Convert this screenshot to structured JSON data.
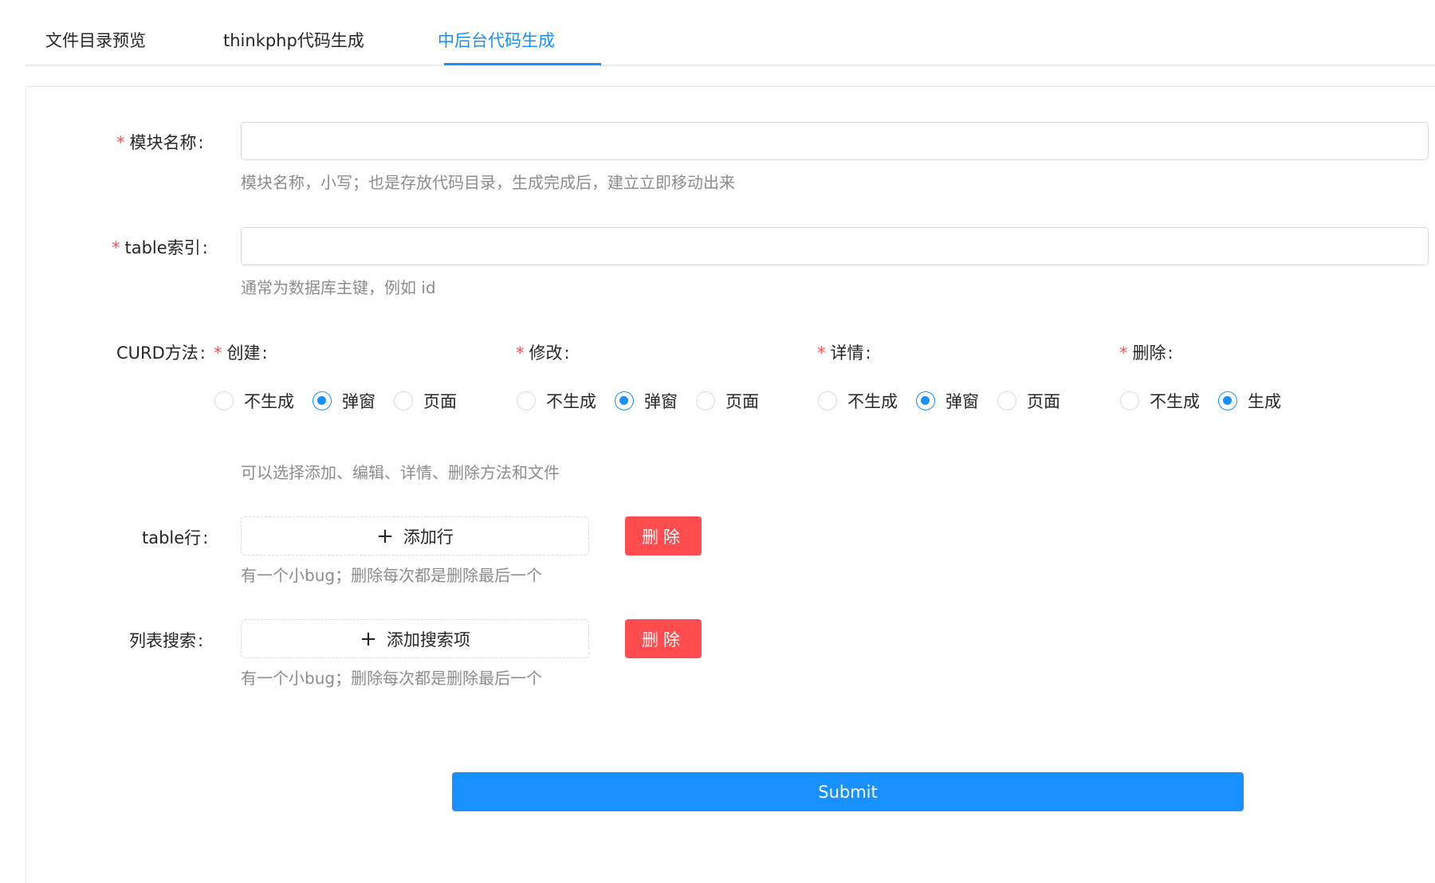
{
  "tabs": [
    {
      "label": "文件目录预览"
    },
    {
      "label": "thinkphp代码生成"
    },
    {
      "label": "中后台代码生成"
    }
  ],
  "form": {
    "module_name": {
      "label": "模块名称",
      "value": "",
      "help": "模块名称，小写；也是存放代码目录，生成完成后，建立立即移动出来"
    },
    "table_index": {
      "label": "table索引",
      "value": "",
      "help": "通常为数据库主键，例如 id"
    },
    "curd": {
      "label": "CURD方法",
      "help": "可以选择添加、编辑、详情、删除方法和文件",
      "groups": [
        {
          "label": "创建",
          "options": [
            "不生成",
            "弹窗",
            "页面"
          ],
          "selected": "弹窗"
        },
        {
          "label": "修改",
          "options": [
            "不生成",
            "弹窗",
            "页面"
          ],
          "selected": "弹窗"
        },
        {
          "label": "详情",
          "options": [
            "不生成",
            "弹窗",
            "页面"
          ],
          "selected": "弹窗"
        },
        {
          "label": "删除",
          "options": [
            "不生成",
            "生成"
          ],
          "selected": "生成"
        }
      ]
    },
    "table_rows": {
      "label": "table行",
      "add_label": "添加行",
      "delete_label": "删除",
      "help": "有一个小bug；删除每次都是删除最后一个"
    },
    "list_search": {
      "label": "列表搜索",
      "add_label": "添加搜索项",
      "delete_label": "删除",
      "help": "有一个小bug；删除每次都是删除最后一个"
    },
    "submit_label": "Submit"
  },
  "colors": {
    "primary": "#1890ff",
    "danger": "#ff4d4f",
    "help_text": "#8c8c8c",
    "border": "#d9d9d9"
  }
}
